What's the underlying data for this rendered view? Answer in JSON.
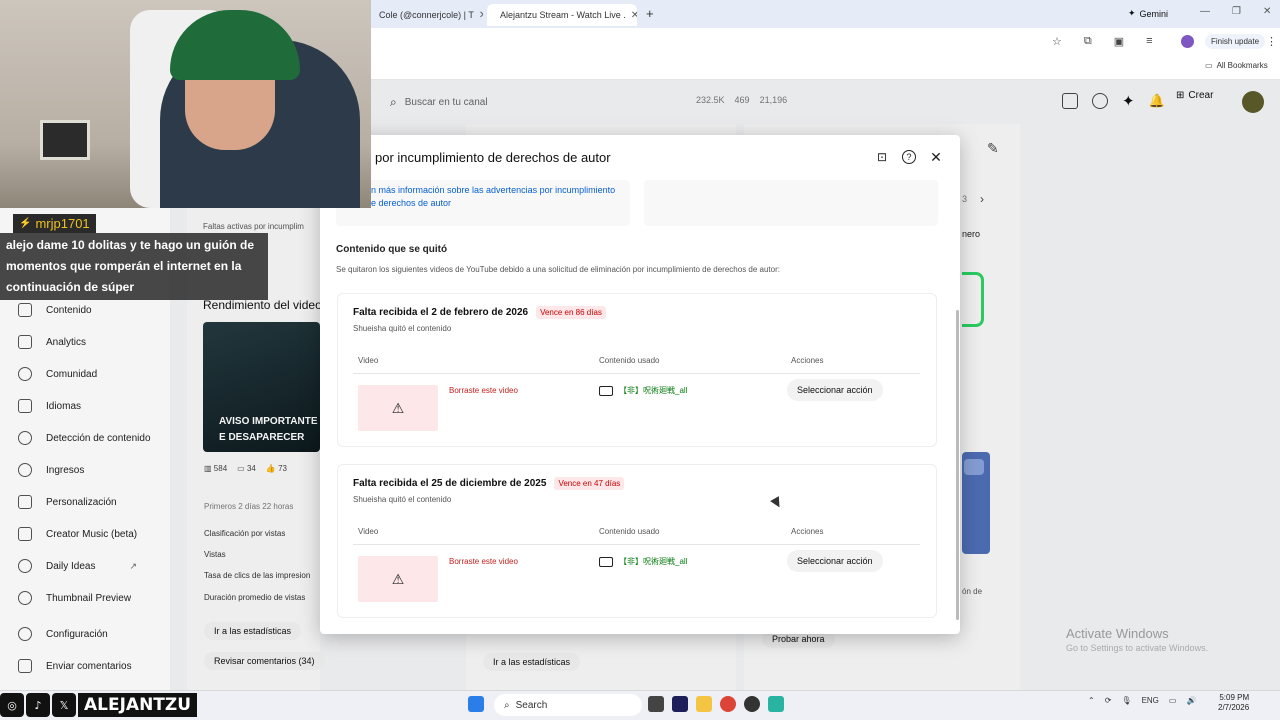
{
  "browser": {
    "tabs": [
      {
        "label": "Cole (@connerjcole) | T"
      },
      {
        "label": "Alejantzu Stream - Watch Live ."
      }
    ],
    "gemini_label": "Gemini",
    "finish_update_label": "Finish update",
    "all_bookmarks_label": "All Bookmarks"
  },
  "studio": {
    "search_placeholder": "Buscar en tu canal",
    "stats": [
      "232.5K",
      "469",
      "21,196"
    ],
    "create_label": "Crear",
    "sidebar": [
      {
        "label": "Contenido",
        "icon": "content-icon"
      },
      {
        "label": "Analytics",
        "icon": "analytics-icon"
      },
      {
        "label": "Comunidad",
        "icon": "community-icon"
      },
      {
        "label": "Idiomas",
        "icon": "languages-icon"
      },
      {
        "label": "Detección de contenido",
        "icon": "copyright-icon"
      },
      {
        "label": "Ingresos",
        "icon": "dollar-icon"
      },
      {
        "label": "Personalización",
        "icon": "brush-icon"
      },
      {
        "label": "Creator Music (beta)",
        "icon": "music-icon"
      },
      {
        "label": "Daily Ideas",
        "icon": "ideas-icon"
      },
      {
        "label": "Thumbnail Preview",
        "icon": "preview-icon"
      },
      {
        "label": "Configuración",
        "icon": "gear-icon"
      },
      {
        "label": "Enviar comentarios",
        "icon": "feedback-icon"
      }
    ],
    "left": {
      "faltas": "Faltas activas por incumplim",
      "rendimiento": "Rendimiento del video",
      "video_overlay": "AVISO IMPORTANTE E DESAPARECER",
      "metrics": [
        "584",
        "34",
        "73"
      ],
      "first_days": "Primeros 2 días 22 horas",
      "rows": [
        "Clasificación por vistas",
        "Vistas",
        "Tasa de clics de las impresion",
        "Duración promedio de vistas"
      ],
      "stats_button": "Ir a las estadísticas",
      "comments_button": "Revisar comentarios (34)"
    },
    "mid": {
      "stats_button": "Ir a las estadísticas"
    },
    "right": {
      "nero": "nero",
      "try_button": "Probar ahora",
      "frac": "3",
      "partial": "ón de"
    }
  },
  "modal": {
    "title": "por incumplimiento de derechos de autor",
    "info_link": "n más información sobre las advertencias por incumplimiento e derechos de autor",
    "section_title": "Contenido que se quitó",
    "section_desc": "Se quitaron los siguientes videos de YouTube debido a una solicitud de eliminación por incumplimiento de derechos de autor:",
    "columns": {
      "video": "Video",
      "content": "Contenido usado",
      "actions": "Acciones"
    },
    "strikes": [
      {
        "title": "Falta recibida el 2 de febrero de 2026",
        "badge": "Vence en 86 días",
        "sub": "Shueisha quitó el contenido",
        "deleted": "Borraste este video",
        "content": "【非】呪術廻戦_all",
        "action": "Seleccionar acción"
      },
      {
        "title": "Falta recibida el 25 de diciembre de 2025",
        "badge": "Vence en 47 días",
        "sub": "Shueisha quitó el contenido",
        "deleted": "Borraste este video",
        "content": "【非】呪術廻戦_all",
        "action": "Seleccionar acción"
      }
    ]
  },
  "stream": {
    "chat_user": "mrjp1701",
    "chat_message": "alejo dame 10 dolitas y te hago un guión de momentos que romperán el internet en la continuación de súper",
    "brand_name": "ALEJANTZU"
  },
  "taskbar": {
    "search": "Search",
    "lang": "ENG",
    "time": "5:09 PM",
    "date": "2/7/2026"
  },
  "watermark": {
    "line1": "Activate Windows",
    "line2": "Go to Settings to activate Windows."
  }
}
